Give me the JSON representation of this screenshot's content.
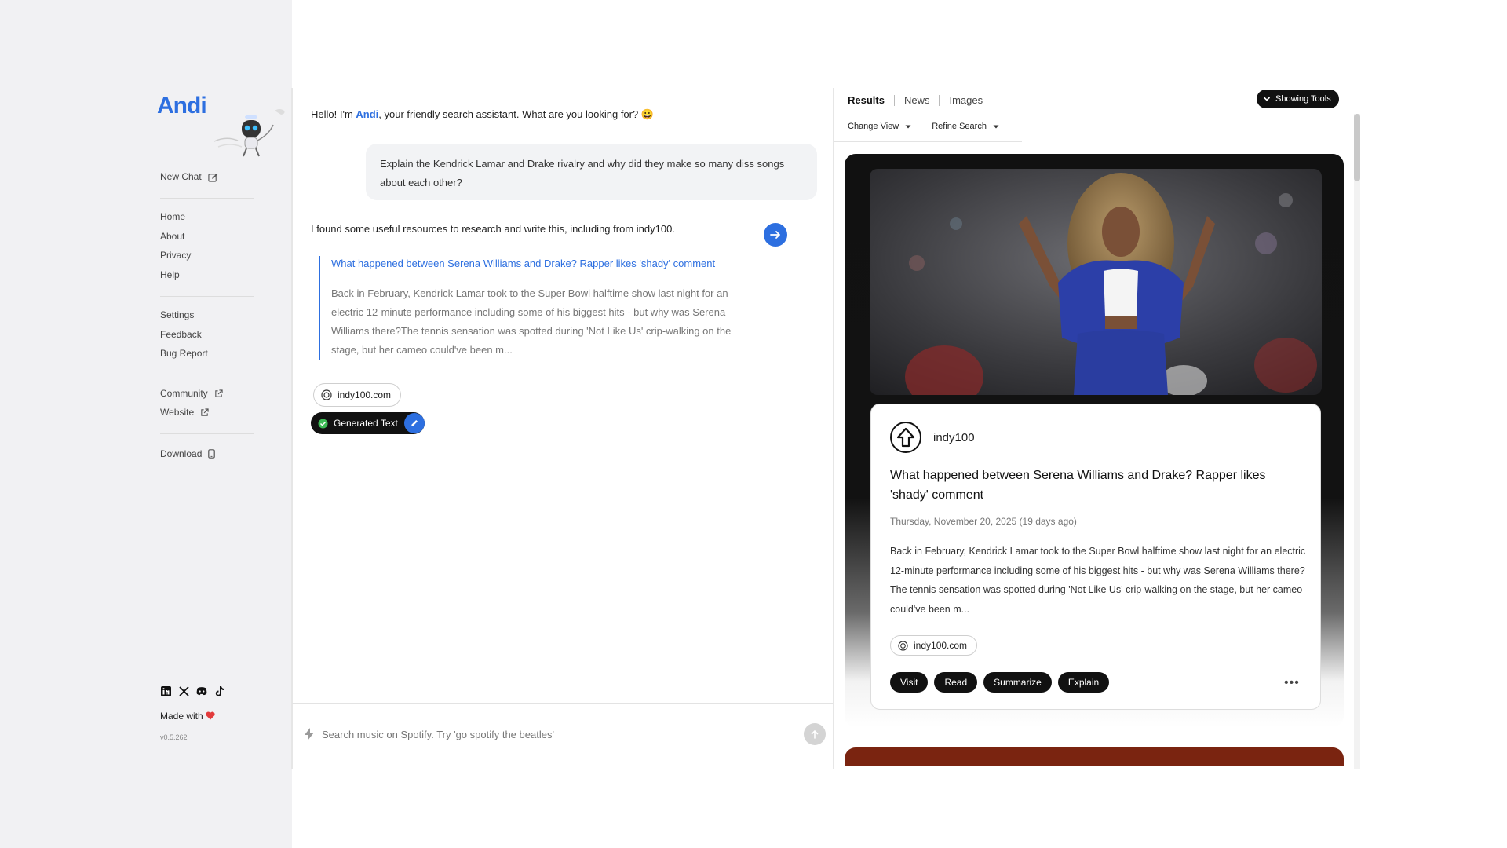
{
  "brand": {
    "logo_text": "Andi",
    "accent": "#2d6fe0"
  },
  "sidebar": {
    "new_chat": "New Chat",
    "group1": [
      "Home",
      "About",
      "Privacy",
      "Help"
    ],
    "group2": [
      "Settings",
      "Feedback",
      "Bug Report"
    ],
    "community": "Community",
    "website": "Website",
    "download": "Download",
    "social_icons": [
      "linkedin-icon",
      "x-icon",
      "discord-icon",
      "tiktok-icon"
    ],
    "made_with": "Made with",
    "version": "v0.5.262"
  },
  "chat": {
    "greeting_prefix": "Hello! I'm ",
    "greeting_name": "Andi",
    "greeting_suffix": ", your friendly search assistant. What are you looking for? 😀",
    "user_message": "Explain the Kendrick Lamar and Drake rivalry and why did they make so many diss songs about each other?",
    "reply_intro": "I found some useful resources to research and write this, including from indy100.",
    "quote_title": "What happened between Serena Williams and Drake? Rapper likes 'shady' comment",
    "quote_body": "Back in February, Kendrick Lamar took to the Super Bowl halftime show last night for an electric 12-minute performance including some of his biggest hits - but why was Serena Williams there?The tennis sensation was spotted during 'Not Like Us' crip-walking on the stage, but her cameo could've been m...",
    "source_pill": "indy100.com",
    "generated_text": "Generated Text"
  },
  "input": {
    "placeholder": "Search music on Spotify. Try 'go spotify the beatles'"
  },
  "results": {
    "tabs": [
      "Results",
      "News",
      "Images"
    ],
    "tools_button": "Showing Tools",
    "change_view": "Change View",
    "refine_search": "Refine Search",
    "card": {
      "source": "indy100",
      "title": "What happened between Serena Williams and Drake? Rapper likes 'shady' comment",
      "date": "Thursday, November 20, 2025 (19 days ago)",
      "body": "Back in February, Kendrick Lamar took to the Super Bowl halftime show last night for an electric 12-minute performance including some of his biggest hits - but why was Serena Williams there?The tennis sensation was spotted during 'Not Like Us' crip-walking on the stage, but her cameo could've been m...",
      "domain_pill": "indy100.com",
      "actions": [
        "Visit",
        "Read",
        "Summarize",
        "Explain"
      ]
    }
  }
}
